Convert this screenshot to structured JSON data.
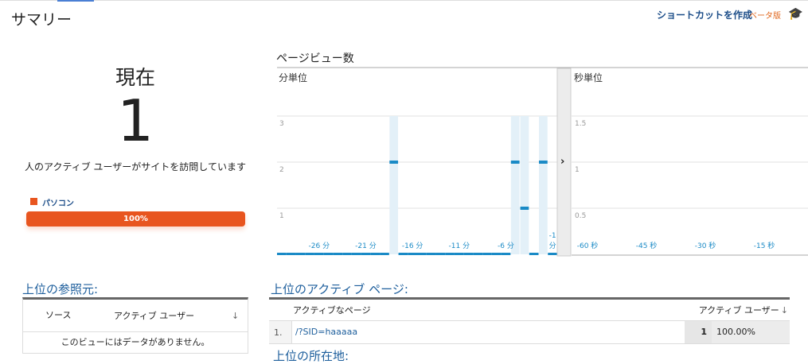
{
  "header": {
    "title": "サマリー",
    "shortcut": "ショートカットを作成",
    "beta": "ベータ版"
  },
  "active": {
    "label": "現在",
    "count": "1",
    "description": "人のアクティブ ユーザーがサイトを訪問しています",
    "device": "パソコン",
    "device_percent": "100%",
    "device_fraction": 1.0,
    "device_color": "#e8551f"
  },
  "pageviews": {
    "title": "ページビュー数"
  },
  "chart_data": [
    {
      "type": "bar",
      "title": "分単位",
      "y_ticks": [
        "1",
        "2",
        "3"
      ],
      "ylim": [
        0,
        3
      ],
      "x_labels": [
        {
          "text": "-26 分",
          "bar": 4
        },
        {
          "text": "-21 分",
          "bar": 9
        },
        {
          "text": "-16 分",
          "bar": 14
        },
        {
          "text": "-11 分",
          "bar": 19
        },
        {
          "text": "-6 分",
          "bar": 24
        },
        {
          "text": "-1 分",
          "bar": 29
        }
      ],
      "values": [
        0,
        0,
        0,
        0,
        0,
        0,
        0,
        0,
        0,
        0,
        0,
        0,
        2,
        0,
        0,
        0,
        0,
        0,
        0,
        0,
        0,
        0,
        0,
        0,
        0,
        2,
        1,
        0,
        2,
        0
      ]
    },
    {
      "type": "bar",
      "title": "秒単位",
      "y_ticks": [
        "0.5",
        "1",
        "1.5"
      ],
      "ylim": [
        0,
        1.5
      ],
      "x_labels": [
        "-60 秒",
        "-45 秒",
        "-30 秒",
        "-15 秒"
      ],
      "values": []
    }
  ],
  "referrers": {
    "title": "上位の参照元:",
    "col_source": "ソース",
    "col_users": "アクティブ ユーザー",
    "empty": "このビューにはデータがありません。"
  },
  "pages": {
    "title": "上位のアクティブ ページ:",
    "col_page": "アクティブなページ",
    "col_users": "アクティブ ユーザー",
    "rows": [
      {
        "rank": "1.",
        "page": "/?SID=haaaaa",
        "users": "1",
        "percent": "100.00%"
      }
    ]
  },
  "next_section": "上位の所在地:"
}
